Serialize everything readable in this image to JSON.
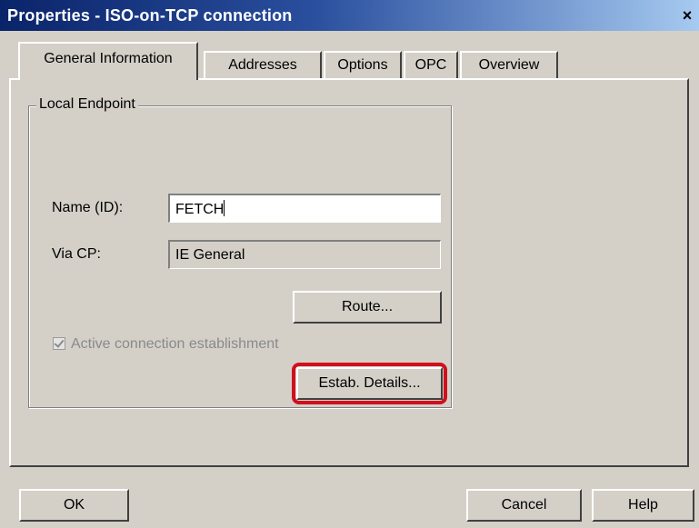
{
  "window": {
    "title": "Properties - ISO-on-TCP connection",
    "close_glyph": "×"
  },
  "tabs": [
    {
      "label": "General Information",
      "active": true
    },
    {
      "label": "Addresses",
      "active": false
    },
    {
      "label": "Options",
      "active": false
    },
    {
      "label": "OPC",
      "active": false
    },
    {
      "label": "Overview",
      "active": false
    }
  ],
  "local_endpoint": {
    "group_label": "Local Endpoint",
    "name_label": "Name (ID):",
    "name_value": "FETCH",
    "via_cp_label": "Via CP:",
    "via_cp_value": "IE General",
    "route_button": "Route...",
    "active_connection_label": "Active connection establishment",
    "active_connection_checked": true,
    "estab_details_button": "Estab. Details..."
  },
  "footer": {
    "ok": "OK",
    "cancel": "Cancel",
    "help": "Help"
  },
  "colors": {
    "highlight": "#d0101c",
    "titlebar": "#0a246a"
  }
}
